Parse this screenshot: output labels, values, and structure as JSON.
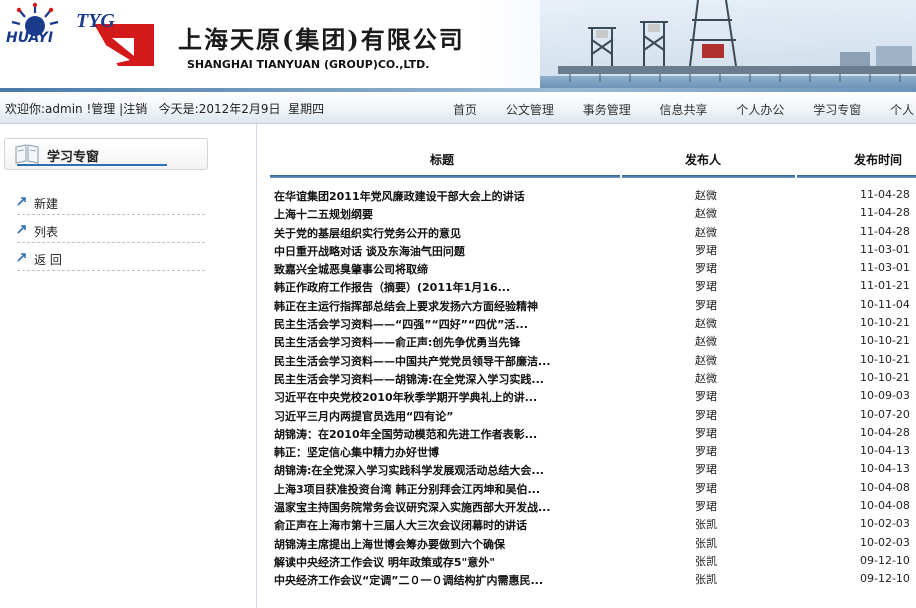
{
  "header": {
    "logo_text": "HUAYI",
    "tyg_text": "TYG",
    "company_cn": "上海天原(集团)有限公司",
    "company_en": "SHANGHAI TIANYUAN (GROUP)CO.,LTD."
  },
  "topbar": {
    "welcome_prefix": "欢迎你:",
    "username": "admin",
    "sep1": "!",
    "manage": "管理",
    "sep2": "|",
    "logout": "注销",
    "today_label": "今天是:",
    "date": "2012年2月9日",
    "weekday": "星期四"
  },
  "nav": [
    "首页",
    "公文管理",
    "事务管理",
    "信息共享",
    "个人办公",
    "学习专窗",
    "个人"
  ],
  "sidebar": {
    "title": "学习专窗",
    "items": [
      "新建",
      "列表",
      "返 回"
    ]
  },
  "table": {
    "headers": {
      "title": "标题",
      "author": "发布人",
      "time": "发布时间"
    },
    "rows": [
      {
        "title": "在华谊集团2011年党风廉政建设干部大会上的讲话",
        "author": "赵微",
        "date": "11-04-28"
      },
      {
        "title": "上海十二五规划纲要",
        "author": "赵微",
        "date": "11-04-28"
      },
      {
        "title": "关于党的基层组织实行党务公开的意见",
        "author": "赵微",
        "date": "11-04-28"
      },
      {
        "title": "中日重开战略对话 谈及东海油气田问题",
        "author": "罗珺",
        "date": "11-03-01"
      },
      {
        "title": "致嘉兴全城恶臭肇事公司将取缔",
        "author": "罗珺",
        "date": "11-03-01"
      },
      {
        "title": "韩正作政府工作报告（摘要）(2011年1月16...",
        "author": "罗珺",
        "date": "11-01-21"
      },
      {
        "title": "韩正在主运行指挥部总结会上要求发扬六方面经验精神",
        "author": "罗珺",
        "date": "10-11-04"
      },
      {
        "title": "民主生活会学习资料——“四强”“四好”“四优”活...",
        "author": "赵微",
        "date": "10-10-21"
      },
      {
        "title": "民主生活会学习资料——俞正声:创先争优勇当先锋",
        "author": "赵微",
        "date": "10-10-21"
      },
      {
        "title": "民主生活会学习资料——中国共产党党员领导干部廉洁...",
        "author": "赵微",
        "date": "10-10-21"
      },
      {
        "title": "民主生活会学习资料——胡锦涛:在全党深入学习实践...",
        "author": "赵微",
        "date": "10-10-21"
      },
      {
        "title": "习近平在中央党校2010年秋季学期开学典礼上的讲...",
        "author": "罗珺",
        "date": "10-09-03"
      },
      {
        "title": "习近平三月内两提官员选用“四有论”",
        "author": "罗珺",
        "date": "10-07-20"
      },
      {
        "title": "胡锦涛：在2010年全国劳动模范和先进工作者表彰...",
        "author": "罗珺",
        "date": "10-04-28"
      },
      {
        "title": "韩正：坚定信心集中精力办好世博",
        "author": "罗珺",
        "date": "10-04-13"
      },
      {
        "title": "胡锦涛:在全党深入学习实践科学发展观活动总结大会...",
        "author": "罗珺",
        "date": "10-04-13"
      },
      {
        "title": "上海3项目获准投资台湾 韩正分别拜会江丙坤和吴伯...",
        "author": "罗珺",
        "date": "10-04-08"
      },
      {
        "title": "温家宝主持国务院常务会议研究深入实施西部大开发战...",
        "author": "罗珺",
        "date": "10-04-08"
      },
      {
        "title": "俞正声在上海市第十三届人大三次会议闭幕时的讲话",
        "author": "张凯",
        "date": "10-02-03"
      },
      {
        "title": "胡锦涛主席提出上海世博会筹办要做到六个确保",
        "author": "张凯",
        "date": "10-02-03"
      },
      {
        "title": "解读中央经济工作会议 明年政策或存5\"意外\"",
        "author": "张凯",
        "date": "09-12-10"
      },
      {
        "title": "中央经济工作会议“定调”二０一０调结构扩内需惠民...",
        "author": "张凯",
        "date": "09-12-10"
      }
    ]
  },
  "icons": {
    "logo": "huayi-logo-icon",
    "tyg": "tyg-logo-icon",
    "side_title": "book-icon",
    "side_item": "arrow-icon"
  },
  "colors": {
    "accent": "#2e6fb3",
    "header_bar": "#4a7aa8",
    "table_rule": "#2c5f8f"
  }
}
